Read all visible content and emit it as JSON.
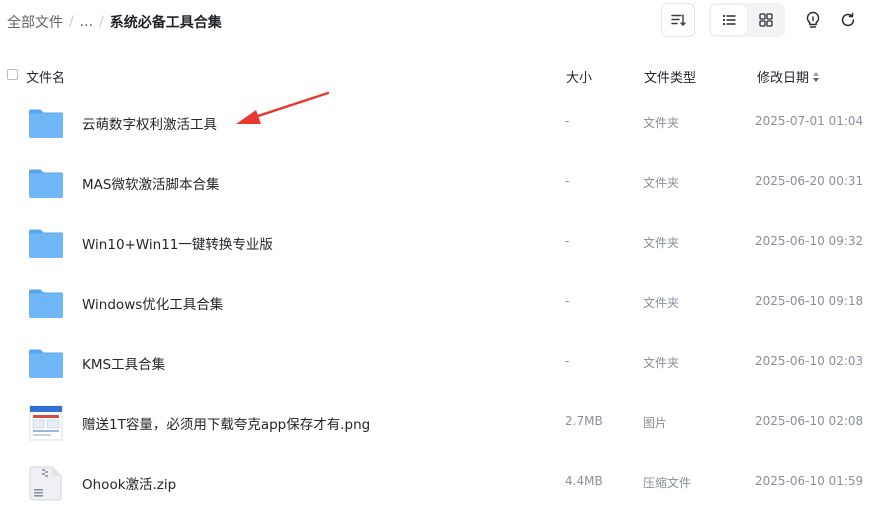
{
  "breadcrumb": {
    "root": "全部文件",
    "ellipsis": "...",
    "current": "系统必备工具合集"
  },
  "header": {
    "name": "文件名",
    "size": "大小",
    "type": "文件类型",
    "date": "修改日期"
  },
  "colors": {
    "folder": "#6fb7f6",
    "folder_dark": "#5aa6ee",
    "accent_arrow": "#e8392f"
  },
  "files": [
    {
      "name": "云萌数字权利激活工具",
      "size": "-",
      "type": "文件夹",
      "date": "2025-07-01 01:04",
      "icon": "folder-icon"
    },
    {
      "name": "MAS微软激活脚本合集",
      "size": "-",
      "type": "文件夹",
      "date": "2025-06-20 00:31",
      "icon": "folder-icon"
    },
    {
      "name": "Win10+Win11一键转换专业版",
      "size": "-",
      "type": "文件夹",
      "date": "2025-06-10 09:32",
      "icon": "folder-icon"
    },
    {
      "name": "Windows优化工具合集",
      "size": "-",
      "type": "文件夹",
      "date": "2025-06-10 09:18",
      "icon": "folder-icon"
    },
    {
      "name": "KMS工具合集",
      "size": "-",
      "type": "文件夹",
      "date": "2025-06-10 02:03",
      "icon": "folder-icon"
    },
    {
      "name": "赠送1T容量，必须用下载夸克app保存才有.png",
      "size": "2.7MB",
      "type": "图片",
      "date": "2025-06-10 02:08",
      "icon": "image-thumbnail-icon"
    },
    {
      "name": "Ohook激活.zip",
      "size": "4.4MB",
      "type": "压缩文件",
      "date": "2025-06-10 01:59",
      "icon": "zip-file-icon"
    }
  ]
}
